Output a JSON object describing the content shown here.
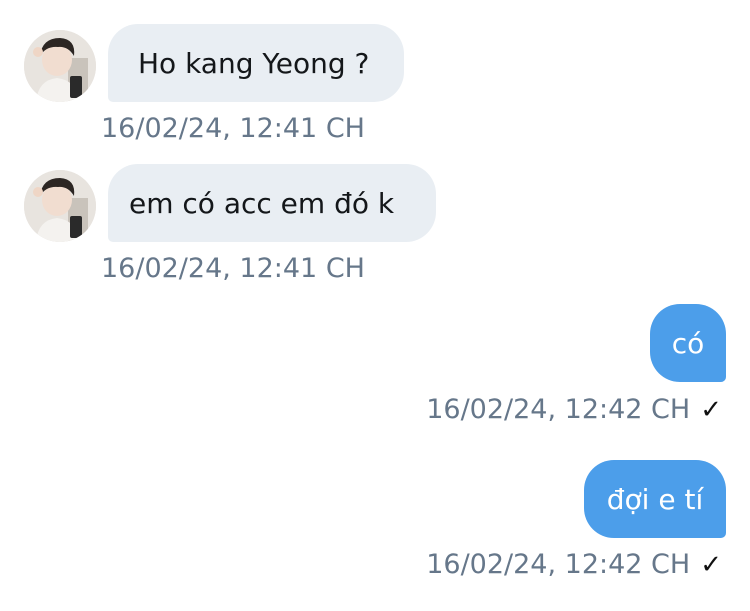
{
  "colors": {
    "incoming_bubble": "#e9eef3",
    "outgoing_bubble": "#4c9eea",
    "timestamp_text": "#66778a"
  },
  "messages": [
    {
      "direction": "incoming",
      "text": "Ho kang Yeong ?",
      "timestamp": "16/02/24, 12:41 CH",
      "avatar_icon": "user-avatar-photo"
    },
    {
      "direction": "incoming",
      "text": "em có acc em đó k",
      "timestamp": "16/02/24, 12:41 CH",
      "avatar_icon": "user-avatar-photo"
    },
    {
      "direction": "outgoing",
      "text": "có",
      "timestamp": "16/02/24, 12:42 CH",
      "status_icon": "checkmark-icon",
      "status": "✓"
    },
    {
      "direction": "outgoing",
      "text": "đợi e tí",
      "timestamp": "16/02/24, 12:42 CH",
      "status_icon": "checkmark-icon",
      "status": "✓"
    }
  ]
}
